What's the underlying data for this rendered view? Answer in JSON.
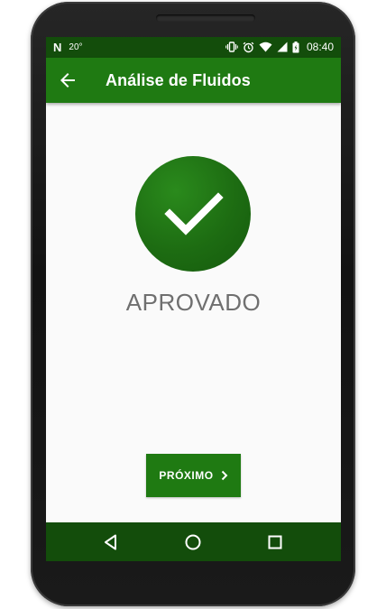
{
  "status_bar": {
    "left_glyph": "N",
    "temperature": "20°",
    "time": "08:40",
    "icons": [
      "n-notification-icon",
      "vibrate-icon",
      "alarm-icon",
      "wifi-icon",
      "signal-icon",
      "battery-icon"
    ]
  },
  "app_bar": {
    "back_icon": "arrow-left-icon",
    "title": "Análise de Fluidos"
  },
  "result": {
    "icon": "check-icon",
    "status": "APROVADO"
  },
  "actions": {
    "next_label": "PRÓXIMO",
    "next_icon": "chevron-right-icon"
  },
  "nav_bar": {
    "icons": [
      "back-triangle-icon",
      "home-circle-icon",
      "recents-square-icon"
    ]
  },
  "colors": {
    "status_bar": "#134d0b",
    "app_bar": "#1f7a12",
    "accent": "#1d6c12",
    "status_text": "#6f6f6f",
    "background": "#fafafa"
  }
}
